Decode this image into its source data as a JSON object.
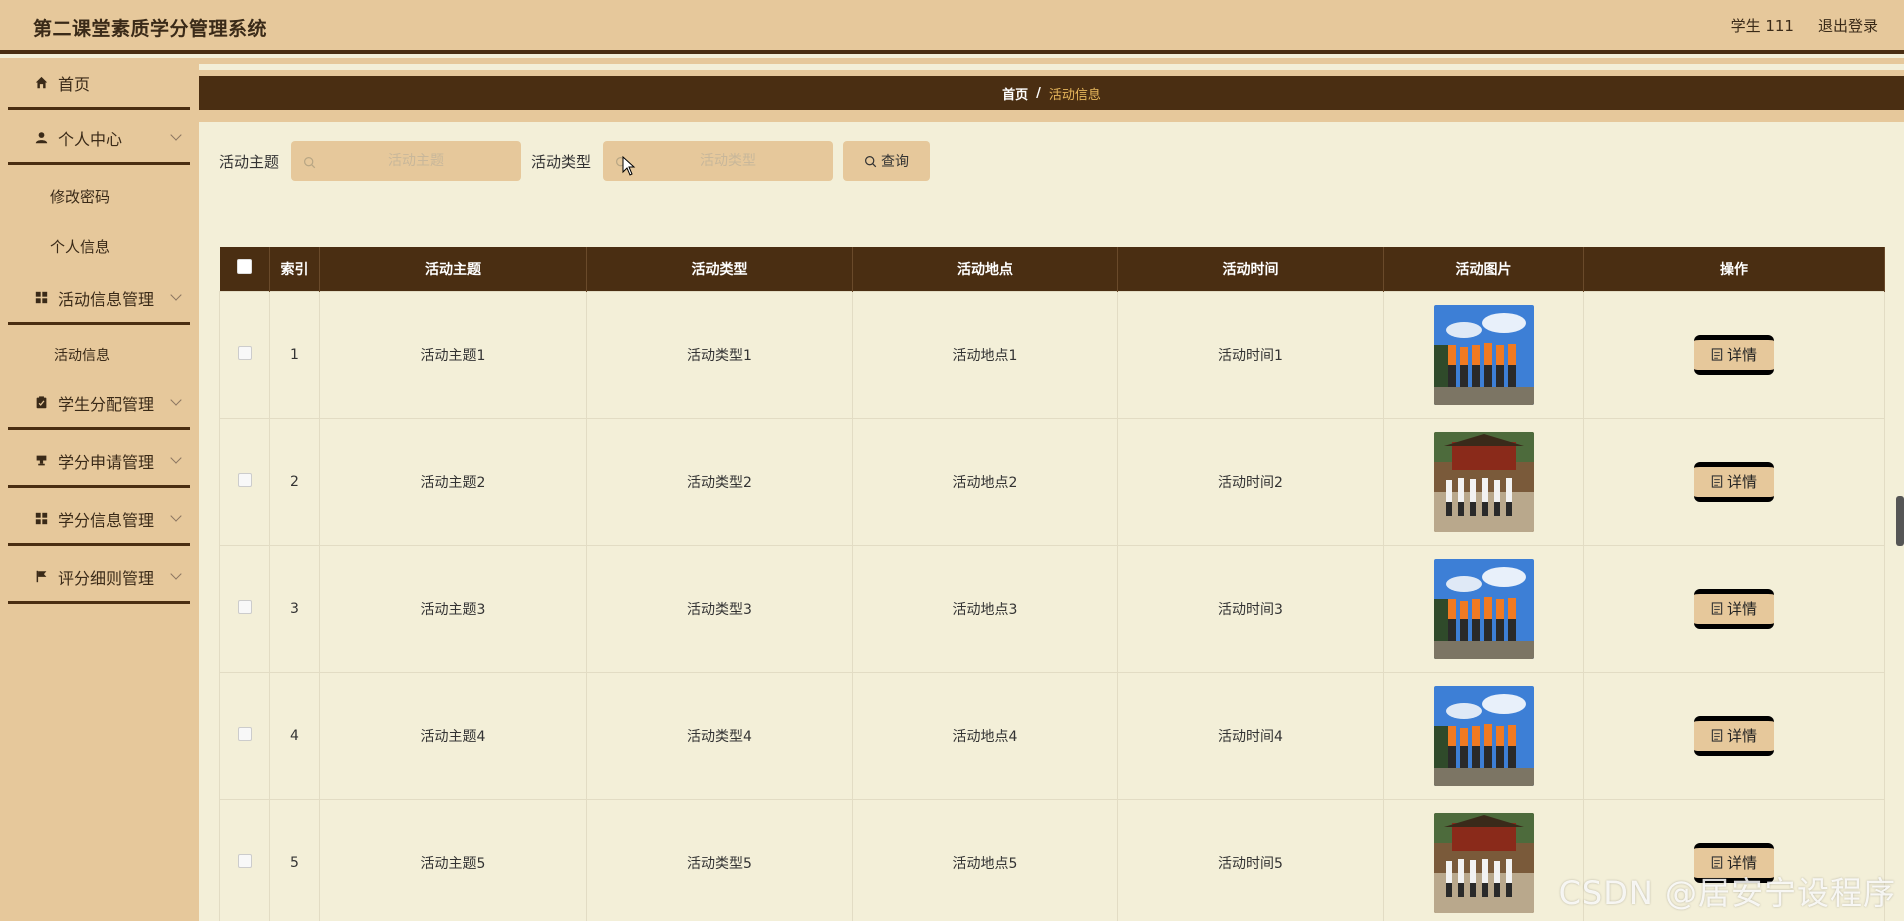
{
  "header": {
    "app_title": "第二课堂素质学分管理系统",
    "user_label": "学生 111",
    "logout_label": "退出登录"
  },
  "sidebar": {
    "items": [
      {
        "label": "首页",
        "icon": "home-icon"
      },
      {
        "label": "个人中心",
        "icon": "user-icon",
        "children": [
          "修改密码",
          "个人信息"
        ]
      },
      {
        "label": "活动信息管理",
        "icon": "grid-icon",
        "children": [
          "活动信息"
        ]
      },
      {
        "label": "学生分配管理",
        "icon": "clipboard-icon"
      },
      {
        "label": "学分申请管理",
        "icon": "stamp-icon"
      },
      {
        "label": "学分信息管理",
        "icon": "grid-icon"
      },
      {
        "label": "评分细则管理",
        "icon": "flag-icon"
      }
    ]
  },
  "breadcrumb": {
    "home": "首页",
    "separator": "/",
    "current": "活动信息"
  },
  "search": {
    "topic_label": "活动主题",
    "topic_placeholder": "活动主题",
    "type_label": "活动类型",
    "type_placeholder": "活动类型",
    "query_label": "查询"
  },
  "table": {
    "headers": [
      "索引",
      "活动主题",
      "活动类型",
      "活动地点",
      "活动时间",
      "活动图片",
      "操作"
    ],
    "rows": [
      {
        "index": "1",
        "topic": "活动主题1",
        "type": "活动类型1",
        "place": "活动地点1",
        "time": "活动时间1",
        "photo": "group-photo-orange-team"
      },
      {
        "index": "2",
        "topic": "活动主题2",
        "type": "活动类型2",
        "place": "活动地点2",
        "time": "活动时间2",
        "photo": "group-photo-pavilion"
      },
      {
        "index": "3",
        "topic": "活动主题3",
        "type": "活动类型3",
        "place": "活动地点3",
        "time": "活动时间3",
        "photo": "group-photo-orange-team"
      },
      {
        "index": "4",
        "topic": "活动主题4",
        "type": "活动类型4",
        "place": "活动地点4",
        "time": "活动时间4",
        "photo": "group-photo-orange-team"
      },
      {
        "index": "5",
        "topic": "活动主题5",
        "type": "活动类型5",
        "place": "活动地点5",
        "time": "活动时间5",
        "photo": "group-photo-pavilion"
      }
    ],
    "detail_label": "详情"
  },
  "watermark": "CSDN @居安宁设程序",
  "colors": {
    "accent_bg": "#e6c89b",
    "dark_brown": "#4a2e12",
    "page_bg": "#f3efd8",
    "breadcrumb_current": "#e8b85c"
  }
}
